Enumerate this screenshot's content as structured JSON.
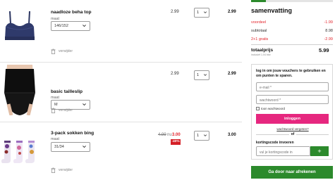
{
  "cart": {
    "items": [
      {
        "name": "naadloze beha top",
        "size_label": "maat",
        "size_value": "146/152",
        "price": "2.99",
        "quantity": "1",
        "line_total": "2.99",
        "remove_label": "verwijder"
      },
      {
        "name": "basic tailleslip",
        "size_label": "maat",
        "size_value": "M",
        "price": "2.99",
        "quantity": "1",
        "line_total": "2.99",
        "remove_label": "verwijder"
      },
      {
        "name": "3-pack sokken bing",
        "size_label": "maat",
        "size_value": "31/34",
        "old_price": "4.99",
        "price_separator": "nu",
        "sale_price": "3.00",
        "discount": "-40%",
        "quantity": "1",
        "line_total": "3.00",
        "remove_label": "verwijder"
      }
    ]
  },
  "summary": {
    "title": "samenvatting",
    "progress_fraction": 0.18,
    "lines": [
      {
        "label": "voordeel",
        "value": "-1.99"
      },
      {
        "label": "subtotaal",
        "value": "8.98"
      },
      {
        "label": "2+1 gratis",
        "value": "-2.99"
      }
    ],
    "total_label": "totaalprijs",
    "total_value": "5.99",
    "vat_note": "inclusief 1.04 btw"
  },
  "login": {
    "text": "log in om jouw vouchers te gebruiken en om punten te sparen.",
    "email_placeholder": "e-mail *",
    "password_placeholder": "wachtwoord *",
    "show_password_label": "toon wachtwoord",
    "login_button": "inloggen",
    "forgot_link": "wachtwoord vergeten?",
    "or_label": "of",
    "coupon_label": "kortingscode invoeren",
    "coupon_placeholder": "vul je kortingscode in",
    "coupon_add_button": "+"
  },
  "checkout": {
    "button_label": "Ga door naar afrekenen"
  },
  "colors": {
    "accent_green": "#2c8a2c",
    "accent_pink": "#e6277f",
    "discount_red": "#e3242b"
  }
}
